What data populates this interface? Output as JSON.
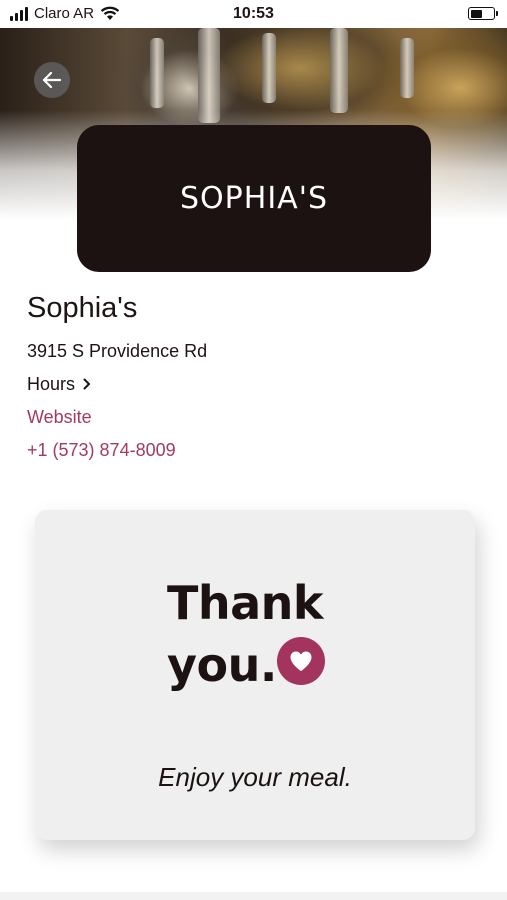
{
  "status_bar": {
    "carrier": "Claro AR",
    "time": "10:53",
    "battery_level": 0.55,
    "icons": [
      "signal-icon",
      "wifi-icon",
      "battery-icon"
    ]
  },
  "header": {
    "back_icon": "arrow-left-icon",
    "logo_text": "SOPHIA'S"
  },
  "restaurant": {
    "name": "Sophia's",
    "address": "3915 S Providence Rd",
    "hours_label": "Hours",
    "hours_icon": "chevron-right-icon",
    "website_label": "Website",
    "phone": "+1 (573) 874-8009"
  },
  "thanks_card": {
    "line1": "Thank",
    "line2": "you.",
    "icon": "heart-icon",
    "message": "Enjoy your meal."
  },
  "colors": {
    "accent": "#a23a62",
    "logo_background": "#1d1212",
    "card_background": "#efefef",
    "heart_badge": "#a3345d"
  }
}
